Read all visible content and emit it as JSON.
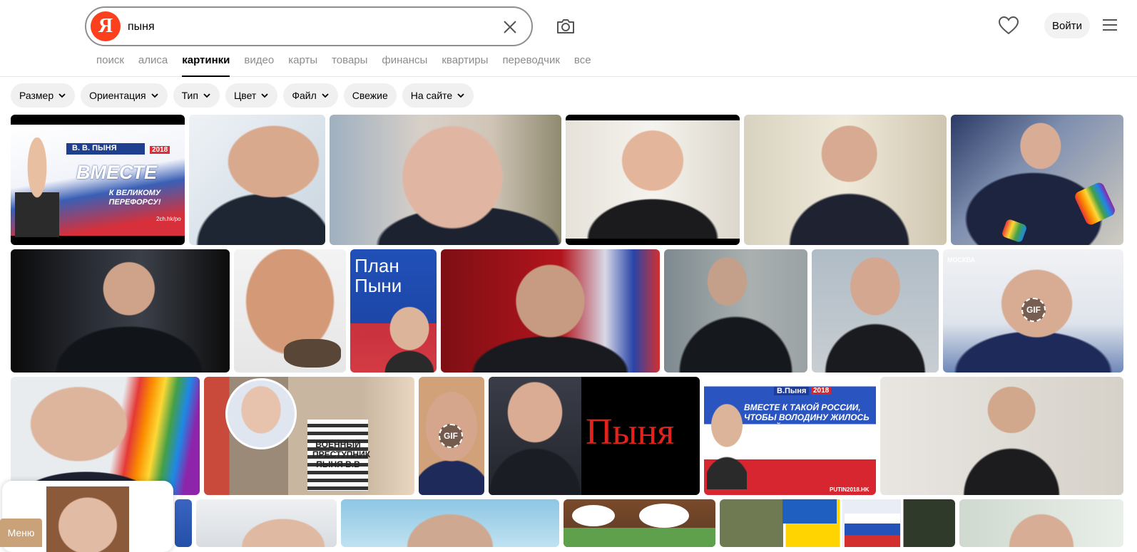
{
  "logo": {
    "glyph": "Я",
    "color": "#fc3f1d"
  },
  "search": {
    "value": "пыня",
    "placeholder": ""
  },
  "icons": {
    "clear": "close-icon",
    "camera": "camera-icon",
    "favorites": "heart-icon",
    "menu": "burger-menu-icon"
  },
  "header": {
    "login_label": "Войти"
  },
  "tabs": [
    {
      "label": "поиск",
      "active": false
    },
    {
      "label": "алиса",
      "active": false
    },
    {
      "label": "картинки",
      "active": true
    },
    {
      "label": "видео",
      "active": false
    },
    {
      "label": "карты",
      "active": false
    },
    {
      "label": "товары",
      "active": false
    },
    {
      "label": "финансы",
      "active": false
    },
    {
      "label": "квартиры",
      "active": false
    },
    {
      "label": "переводчик",
      "active": false
    },
    {
      "label": "все",
      "active": false
    }
  ],
  "filters": [
    {
      "label": "Размер",
      "dropdown": true
    },
    {
      "label": "Ориентация",
      "dropdown": true
    },
    {
      "label": "Тип",
      "dropdown": true
    },
    {
      "label": "Цвет",
      "dropdown": true
    },
    {
      "label": "Файл",
      "dropdown": true
    },
    {
      "label": "Свежие",
      "dropdown": false
    },
    {
      "label": "На сайте",
      "dropdown": true
    }
  ],
  "images": {
    "poster_1": {
      "header": "В. В. ПЫНЯ",
      "year": "2018",
      "title": "ВМЕСТЕ",
      "subtitle": "К ВЕЛИКОМУ ПЕРЕФОРСУ!",
      "credit": "2ch.hk/po"
    },
    "poster_2": {
      "title_line1": "План",
      "title_line2": "Пыни"
    },
    "gif_label": "GIF",
    "moscow_label": "МОСКВА",
    "sign_label": "ВОЕННЫЙ ПРЕСТУПНИК ПЫНЯ В.В",
    "big_word": "Пыня",
    "poster_3": {
      "header": "В.Пыня",
      "year": "2018",
      "title": "ВМЕСТЕ К ТАКОЙ РОССИИ, ЧТОБЫ ВОЛОДИНУ ЖИЛОСЬ СПОКОЙНО!",
      "footer": "PUTIN2018.HK"
    }
  },
  "menu_label": "Меню"
}
